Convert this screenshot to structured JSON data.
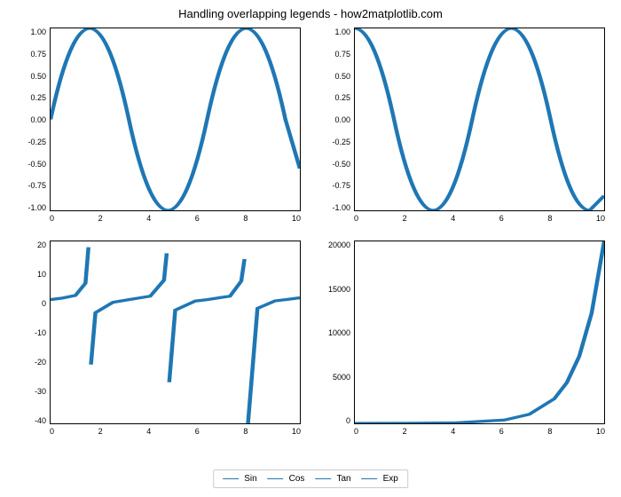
{
  "title": "Handling overlapping legends - how2matplotlib.com",
  "legend": {
    "items": [
      "Sin",
      "Cos",
      "Tan",
      "Exp"
    ]
  },
  "panels": {
    "sin": {
      "xticks": [
        "0",
        "2",
        "4",
        "6",
        "8",
        "10"
      ],
      "yticks": [
        "1.00",
        "0.75",
        "0.50",
        "0.25",
        "0.00",
        "-0.25",
        "-0.50",
        "-0.75",
        "-1.00"
      ]
    },
    "cos": {
      "xticks": [
        "0",
        "2",
        "4",
        "6",
        "8",
        "10"
      ],
      "yticks": [
        "1.00",
        "0.75",
        "0.50",
        "0.25",
        "0.00",
        "-0.25",
        "-0.50",
        "-0.75",
        "-1.00"
      ]
    },
    "tan": {
      "xticks": [
        "0",
        "2",
        "4",
        "6",
        "8",
        "10"
      ],
      "yticks": [
        "20",
        "10",
        "0",
        "-10",
        "-20",
        "-30",
        "-40"
      ]
    },
    "exp": {
      "xticks": [
        "0",
        "2",
        "4",
        "6",
        "8",
        "10"
      ],
      "yticks": [
        "20000",
        "15000",
        "10000",
        "5000",
        "0"
      ]
    }
  },
  "chart_data": [
    {
      "name": "Sin",
      "type": "line",
      "series_name": "Sin",
      "xlim": [
        0,
        10
      ],
      "ylim": [
        -1.0,
        1.0
      ],
      "formula": "y = sin(x)",
      "sample": {
        "x": [
          0,
          1.57,
          3.14,
          4.71,
          6.28,
          7.85,
          9.42,
          10
        ],
        "y": [
          0,
          1,
          0,
          -1,
          0,
          1,
          0,
          -0.54
        ]
      }
    },
    {
      "name": "Cos",
      "type": "line",
      "series_name": "Cos",
      "xlim": [
        0,
        10
      ],
      "ylim": [
        -1.0,
        1.0
      ],
      "formula": "y = cos(x)",
      "sample": {
        "x": [
          0,
          1.57,
          3.14,
          4.71,
          6.28,
          7.85,
          9.42,
          10
        ],
        "y": [
          1,
          0,
          -1,
          0,
          1,
          0,
          -1,
          -0.84
        ]
      }
    },
    {
      "name": "Tan",
      "type": "line",
      "series_name": "Tan",
      "xlim": [
        0,
        10
      ],
      "ylim": [
        -42,
        20
      ],
      "formula": "y = tan(x) with asymptotes near x≈1.57, 4.71, 7.85",
      "sample_branches": [
        {
          "x": [
            0,
            0.5,
            1.0,
            1.4,
            1.52
          ],
          "y": [
            0,
            0.55,
            1.56,
            5.8,
            18
          ]
        },
        {
          "x": [
            1.62,
            1.8,
            2.5,
            3.14,
            4.0,
            4.55,
            4.66
          ],
          "y": [
            -22,
            -4.3,
            -0.75,
            0,
            1.16,
            6.6,
            16
          ]
        },
        {
          "x": [
            4.76,
            5.0,
            5.8,
            6.28,
            7.2,
            7.65,
            7.78
          ],
          "y": [
            -28,
            -3.4,
            -0.47,
            0,
            1.18,
            6.3,
            14
          ]
        },
        {
          "x": [
            7.92,
            8.3,
            9.0,
            9.5,
            10
          ],
          "y": [
            -42,
            -2.8,
            -0.45,
            0.08,
            0.65
          ]
        }
      ]
    },
    {
      "name": "Exp",
      "type": "line",
      "series_name": "Exp",
      "xlim": [
        0,
        10
      ],
      "ylim": [
        0,
        22000
      ],
      "formula": "y = exp(x)",
      "sample": {
        "x": [
          0,
          2,
          4,
          6,
          7,
          8,
          8.5,
          9,
          9.5,
          10
        ],
        "y": [
          1,
          7.4,
          54.6,
          403,
          1097,
          2981,
          4915,
          8103,
          13360,
          22026
        ]
      }
    }
  ]
}
